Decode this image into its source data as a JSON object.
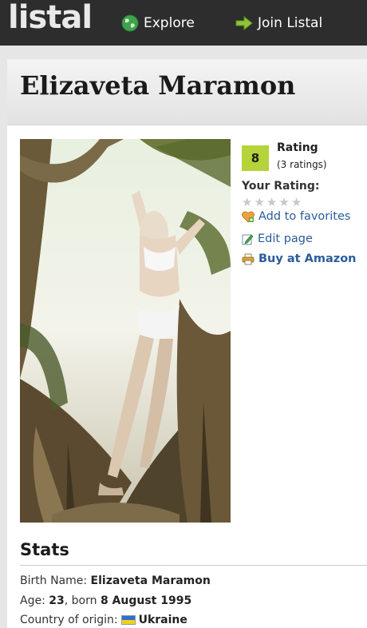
{
  "nav": {
    "logo": "listal",
    "explore": "Explore",
    "join": "Join Listal"
  },
  "person": {
    "name": "Elizaveta Maramon"
  },
  "rating": {
    "score": "8",
    "label": "Rating",
    "count": "(3 ratings)",
    "your_rating_label": "Your Rating:",
    "user_stars": 0,
    "max_stars": 5
  },
  "actions": {
    "favorites": "Add to favorites",
    "edit": "Edit page",
    "amazon": "Buy at Amazon"
  },
  "stats": {
    "title": "Stats",
    "birth_name_label": "Birth Name:",
    "birth_name": "Elizaveta Maramon",
    "age_label": "Age:",
    "age": "23",
    "born_text": ", born",
    "birth_date": "8 August 1995",
    "country_label": "Country of origin:",
    "country": "Ukraine"
  },
  "colors": {
    "topbar": "#2d2d2d",
    "rating_box": "#b5d33a",
    "link": "#2a5c9c",
    "flag_top": "#2f6fd1",
    "flag_bottom": "#f3d21c"
  },
  "icons": {
    "explore": "globe-icon",
    "join": "arrow-right-icon",
    "favorites": "heart-plus-icon",
    "edit": "pencil-icon",
    "amazon": "printer-icon",
    "country": "ukraine-flag-icon"
  }
}
